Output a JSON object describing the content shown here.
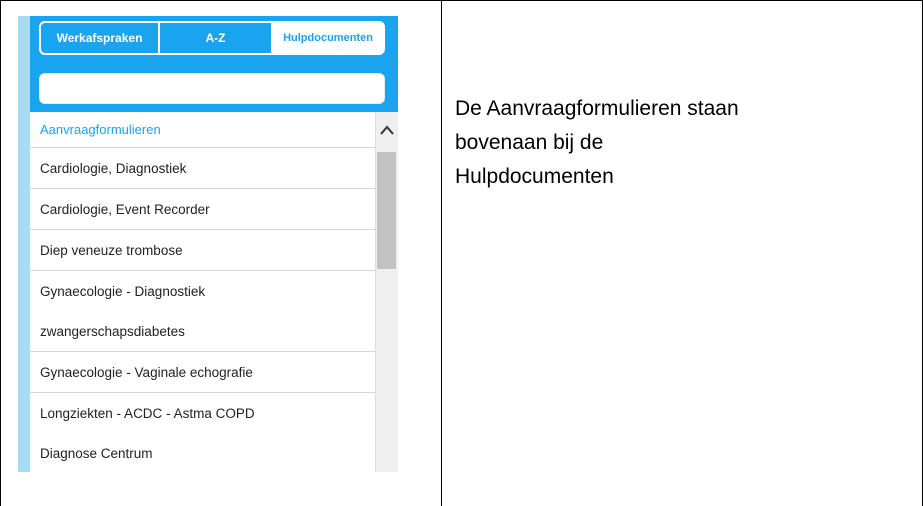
{
  "app": {
    "tabs": [
      {
        "label": "Werkafspraken",
        "active": false
      },
      {
        "label": "A-Z",
        "active": false
      },
      {
        "label": "Hulpdocumenten",
        "active": true
      }
    ],
    "search": {
      "value": "",
      "placeholder": ""
    },
    "list": {
      "header": "Aanvraagformulieren",
      "items": [
        {
          "lines": [
            "Cardiologie, Diagnostiek"
          ]
        },
        {
          "lines": [
            "Cardiologie, Event Recorder"
          ]
        },
        {
          "lines": [
            "Diep veneuze trombose"
          ]
        },
        {
          "lines": [
            "Gynaecologie - Diagnostiek",
            "zwangerschapsdiabetes"
          ]
        },
        {
          "lines": [
            "Gynaecologie - Vaginale echografie"
          ]
        },
        {
          "lines": [
            "Longziekten - ACDC - Astma COPD",
            "Diagnose Centrum"
          ]
        }
      ]
    },
    "scrollbar": {
      "up_icon": "chevron-up-icon"
    }
  },
  "caption": "De Aanvraagformulieren staan\nbovenaan bij de\nHulpdocumenten",
  "colors": {
    "accent_blue": "#1aa3ee",
    "accent_stripe": "#a7ddf4",
    "scroll_thumb": "#c2c2c2"
  }
}
